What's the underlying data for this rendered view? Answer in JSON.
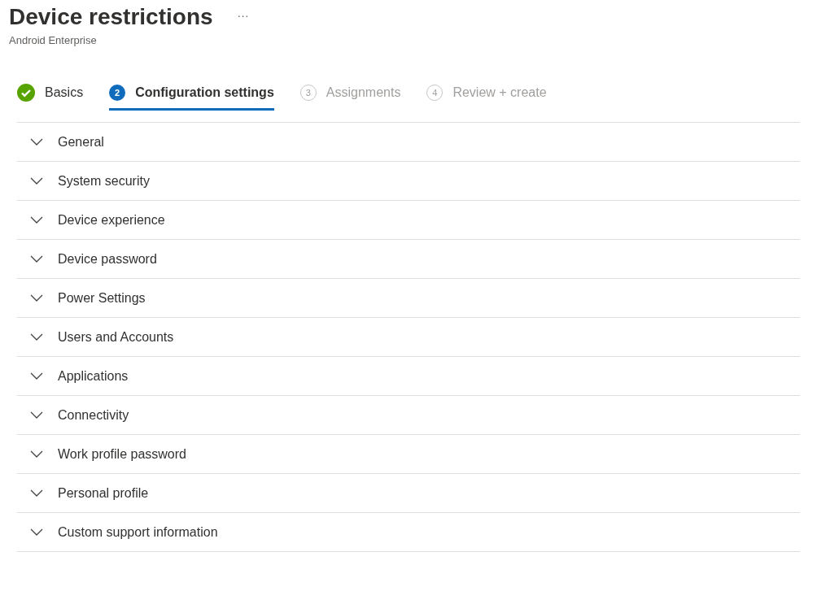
{
  "header": {
    "title": "Device restrictions",
    "more": "···",
    "subtitle": "Android Enterprise"
  },
  "tabs": [
    {
      "label": "Basics",
      "kind": "complete",
      "selected": false
    },
    {
      "label": "Configuration settings",
      "number": "2",
      "kind": "current",
      "selected": true
    },
    {
      "label": "Assignments",
      "number": "3",
      "kind": "pending",
      "selected": false
    },
    {
      "label": "Review + create",
      "number": "4",
      "kind": "pending",
      "selected": false
    }
  ],
  "sections": [
    {
      "label": "General",
      "expanded": false
    },
    {
      "label": "System security",
      "expanded": false
    },
    {
      "label": "Device experience",
      "expanded": false
    },
    {
      "label": "Device password",
      "expanded": false
    },
    {
      "label": "Power Settings",
      "expanded": false
    },
    {
      "label": "Users and Accounts",
      "expanded": false
    },
    {
      "label": "Applications",
      "expanded": false
    },
    {
      "label": "Connectivity",
      "expanded": false
    },
    {
      "label": "Work profile password",
      "expanded": false
    },
    {
      "label": "Personal profile",
      "expanded": false
    },
    {
      "label": "Custom support information",
      "expanded": false
    }
  ]
}
